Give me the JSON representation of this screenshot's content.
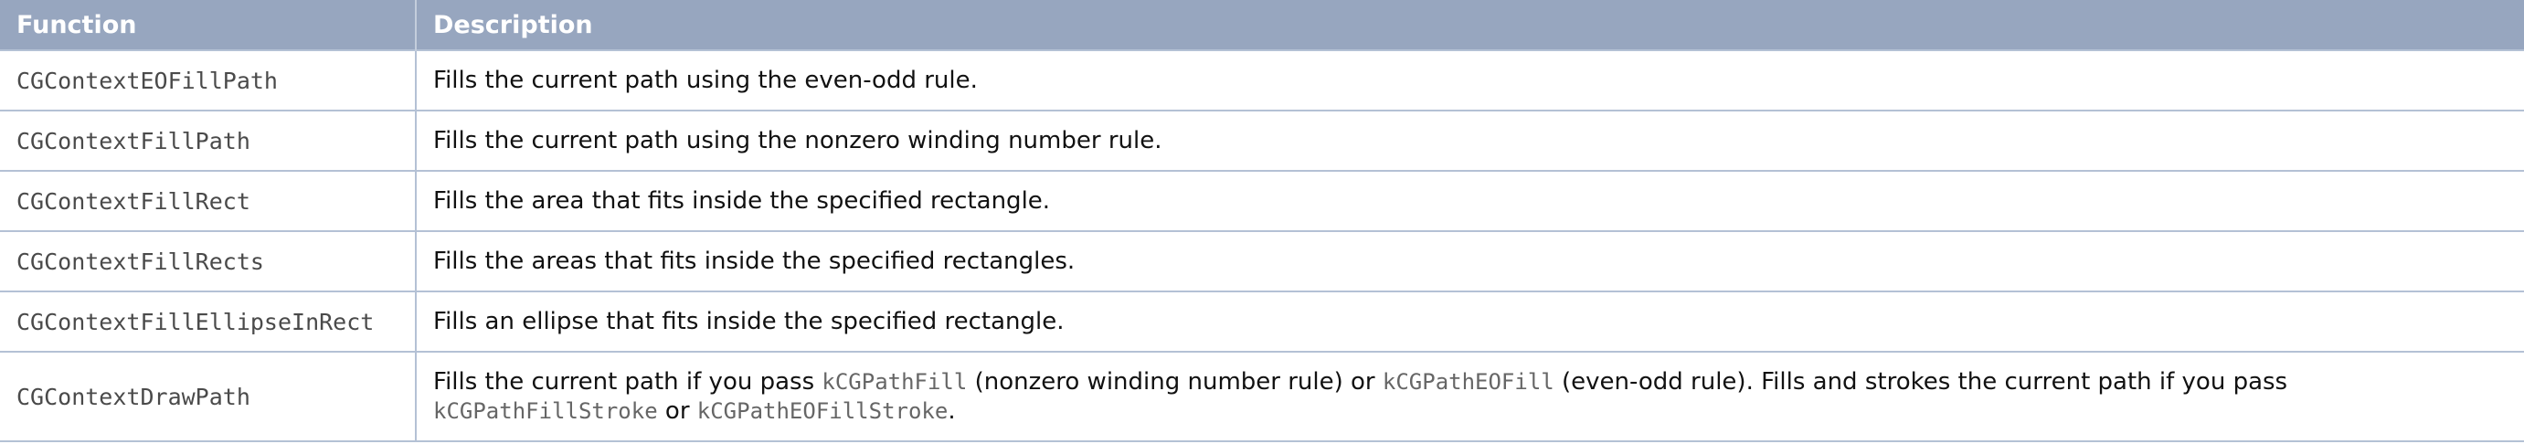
{
  "table": {
    "headers": {
      "function": "Function",
      "description": "Description"
    },
    "rows": [
      {
        "function": "CGContextEOFillPath",
        "description": "Fills the current path using the even-odd rule."
      },
      {
        "function": "CGContextFillPath",
        "description": "Fills the current path using the nonzero winding number rule."
      },
      {
        "function": "CGContextFillRect",
        "description": "Fills the area that fits inside the specified rectangle."
      },
      {
        "function": "CGContextFillRects",
        "description": "Fills the areas that fits inside the specified rectangles."
      },
      {
        "function": "CGContextFillEllipseInRect",
        "description": "Fills an ellipse that fits inside the specified rectangle."
      },
      {
        "function": "CGContextDrawPath",
        "description_parts": {
          "t1": "Fills the current path if you pass ",
          "c1": "kCGPathFill",
          "t2": " (nonzero winding number rule) or ",
          "c2": "kCGPathEOFill",
          "t3": " (even-odd rule). Fills and strokes the current path if you pass",
          "c3": "kCGPathFillStroke",
          "t4": " or ",
          "c4": "kCGPathEOFillStroke",
          "t5": "."
        }
      }
    ]
  }
}
